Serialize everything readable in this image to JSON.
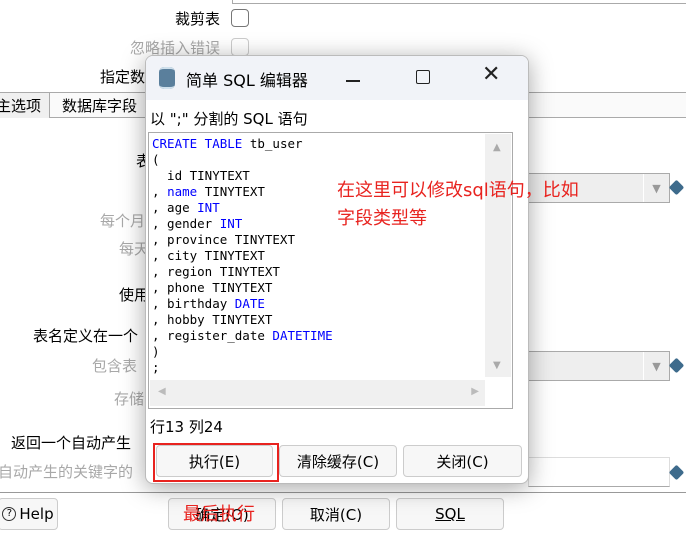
{
  "background": {
    "crop_table_label": "裁剪表",
    "ignore_insert_errors_label": "忽略插入错误",
    "specify_label": "指定数",
    "tabs": [
      {
        "label": "主选项"
      },
      {
        "label": "数据库字段"
      }
    ],
    "label_table": "表",
    "label_each": "每个月",
    "label_each2": "每天",
    "label_use": "使用",
    "label_tablename_in_field": "表名定义在一个",
    "label_include": "包含表",
    "label_store": "存储",
    "label_return_auto": "返回一个自动产生",
    "label_auto_key": "自动产生的关键字的",
    "help_label": "Help",
    "ok_label": "确定(O)",
    "cancel_label": "取消(C)",
    "sql_label": "SQL"
  },
  "dialog": {
    "title": "简单 SQL 编辑器",
    "prompt": "以 \";\" 分割的 SQL 语句",
    "code_lines": [
      [
        {
          "t": "CREATE TABLE",
          "k": 1
        },
        {
          "t": " tb_user"
        }
      ],
      [
        {
          "t": "("
        }
      ],
      [
        {
          "t": "  id TINYTEXT"
        }
      ],
      [
        {
          "t": ", "
        },
        {
          "t": "name",
          "k": 1
        },
        {
          "t": " TINYTEXT"
        }
      ],
      [
        {
          "t": ", age "
        },
        {
          "t": "INT",
          "k": 1
        }
      ],
      [
        {
          "t": ", gender "
        },
        {
          "t": "INT",
          "k": 1
        }
      ],
      [
        {
          "t": ", province TINYTEXT"
        }
      ],
      [
        {
          "t": ", city TINYTEXT"
        }
      ],
      [
        {
          "t": ", region TINYTEXT"
        }
      ],
      [
        {
          "t": ", phone TINYTEXT"
        }
      ],
      [
        {
          "t": ", birthday "
        },
        {
          "t": "DATE",
          "k": 1
        }
      ],
      [
        {
          "t": ", hobby TINYTEXT"
        }
      ],
      [
        {
          "t": ", register_date "
        },
        {
          "t": "DATETIME",
          "k": 1
        }
      ],
      [
        {
          "t": ")"
        }
      ],
      [
        {
          "t": ";"
        }
      ]
    ],
    "status": "行13 列24",
    "execute_label": "执行(E)",
    "clear_cache_label": "清除缓存(C)",
    "close_label": "关闭(C)"
  },
  "annotations": {
    "edit_hint_line1": "在这里可以修改sql语句，比如",
    "edit_hint_line2": "字段类型等",
    "execute_hint": "最后执行",
    "highlight_color": "#e8231f"
  },
  "colors": {
    "keyword": "#0000ff",
    "variable_icon": "#3e6b8c"
  }
}
